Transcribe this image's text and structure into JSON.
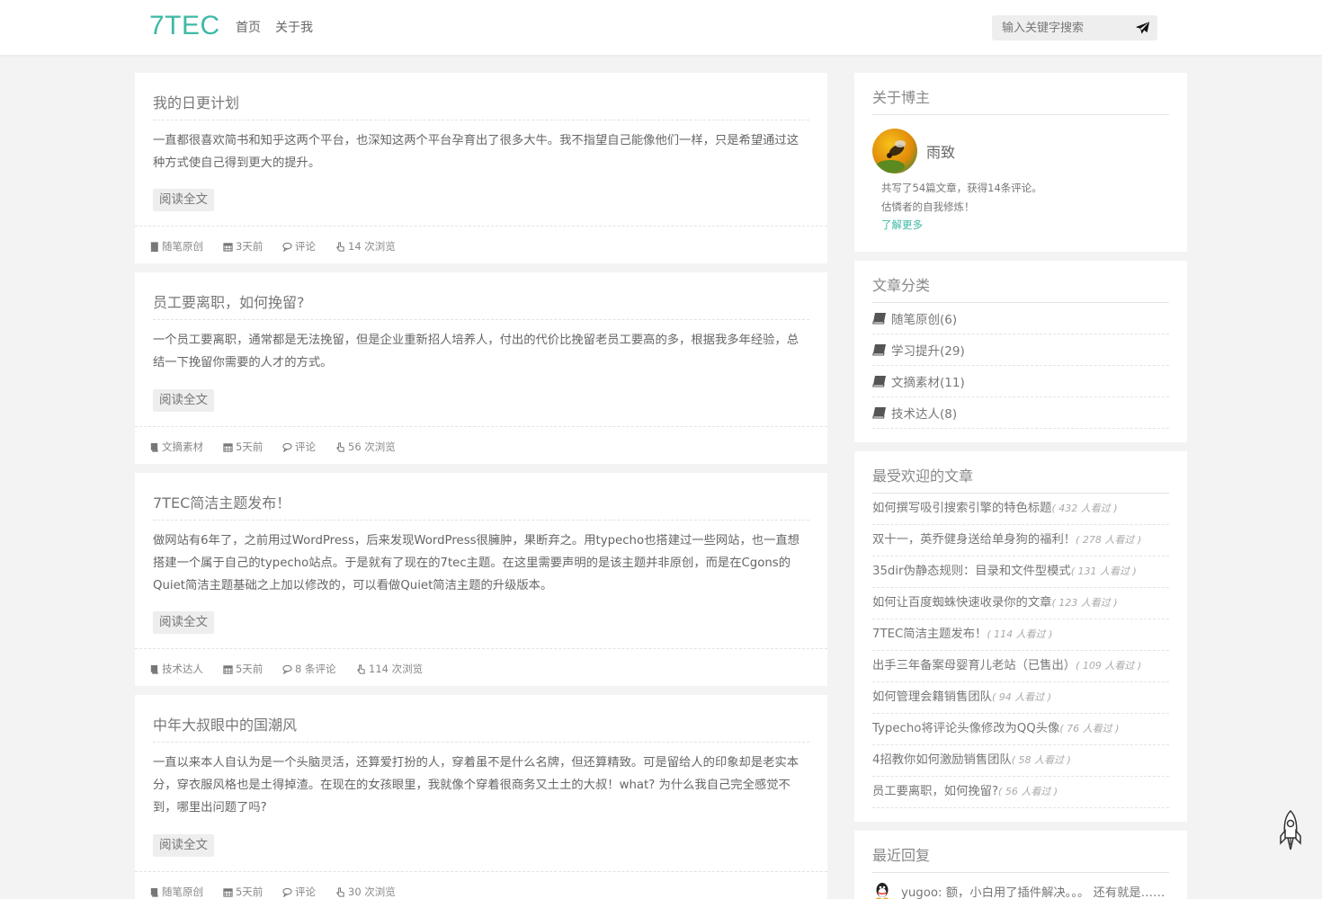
{
  "header": {
    "logo": "7TEC",
    "nav": [
      "首页",
      "关于我"
    ],
    "search_placeholder": "输入关键字搜索"
  },
  "posts": [
    {
      "title": "我的日更计划",
      "excerpt": "一直都很喜欢简书和知乎这两个平台，也深知这两个平台孕育出了很多大牛。我不指望自己能像他们一样，只是希望通过这种方式使自己得到更大的提升。",
      "readmore": "阅读全文",
      "category": "随笔原创",
      "date": "3天前",
      "comments": "评论",
      "views": "14 次浏览"
    },
    {
      "title": "员工要离职，如何挽留?",
      "excerpt": "一个员工要离职，通常都是无法挽留，但是企业重新招人培养人，付出的代价比挽留老员工要高的多，根据我多年经验，总结一下挽留你需要的人才的方式。",
      "readmore": "阅读全文",
      "category": "文摘素材",
      "date": "5天前",
      "comments": "评论",
      "views": "56 次浏览"
    },
    {
      "title": "7TEC简洁主题发布！",
      "excerpt": "做网站有6年了，之前用过WordPress，后来发现WordPress很臃肿，果断弃之。用typecho也搭建过一些网站，也一直想搭建一个属于自己的typecho站点。于是就有了现在的7tec主题。在这里需要声明的是该主题并非原创，而是在Cgons的Quiet简洁主题基础之上加以修改的，可以看做Quiet简洁主题的升级版本。",
      "readmore": "阅读全文",
      "category": "技术达人",
      "date": "5天前",
      "comments": "8 条评论",
      "views": "114 次浏览"
    },
    {
      "title": "中年大叔眼中的国潮风",
      "excerpt": "一直以来本人自认为是一个头脑灵活，还算爱打扮的人，穿着虽不是什么名牌，但还算精致。可是留给人的印象却是老实本分，穿衣服风格也是土得掉渣。在现在的女孩眼里，我就像个穿着很商务又土土的大叔！what? 为什么我自己完全感觉不到，哪里出问题了吗?",
      "readmore": "阅读全文",
      "category": "随笔原创",
      "date": "5天前",
      "comments": "评论",
      "views": "30 次浏览"
    }
  ],
  "sidebar": {
    "about": {
      "title": "关于博主",
      "name": "雨致",
      "stats": "共写了54篇文章，获得14条评论。",
      "motto": "估憐者的自我修炼！",
      "more": "了解更多"
    },
    "categories": {
      "title": "文章分类",
      "items": [
        "随笔原创(6)",
        "学习提升(29)",
        "文摘素材(11)",
        "技术达人(8)"
      ]
    },
    "popular": {
      "title": "最受欢迎的文章",
      "items": [
        {
          "title": "如何撰写吸引搜索引擎的特色标题",
          "views": "( 432 人看过 )"
        },
        {
          "title": "双十一，英乔健身送给单身狗的福利！",
          "views": "( 278 人看过 )"
        },
        {
          "title": "35dir伪静态规则：目录和文件型模式",
          "views": "( 131 人看过 )"
        },
        {
          "title": "如何让百度蜘蛛快速收录你的文章",
          "views": "( 123 人看过 )"
        },
        {
          "title": "7TEC简洁主题发布！",
          "views": "( 114 人看过 )"
        },
        {
          "title": "出手三年备案母婴育儿老站（已售出）",
          "views": "( 109 人看过 )"
        },
        {
          "title": "如何管理会籍销售团队",
          "views": "( 94 人看过 )"
        },
        {
          "title": "Typecho将评论头像修改为QQ头像",
          "views": "( 76 人看过 )"
        },
        {
          "title": "4招教你如何激励销售团队",
          "views": "( 58 人看过 )"
        },
        {
          "title": "员工要离职，如何挽留?",
          "views": "( 56 人看过 )"
        }
      ]
    },
    "replies": {
      "title": "最近回复",
      "items": [
        "yugoo: 额，小白用了插件解决。。。 还有就是……"
      ]
    }
  },
  "colors": {
    "accent": "#3cb9a4",
    "background": "#f3f3f3"
  }
}
